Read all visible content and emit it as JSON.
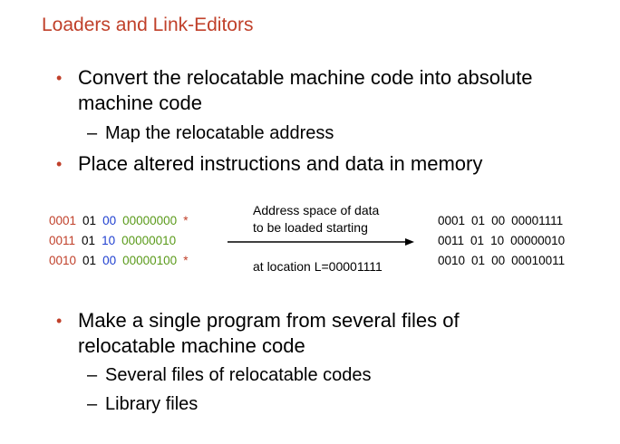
{
  "title": "Loaders and Link-Editors",
  "bullets": [
    {
      "text": "Convert the relocatable machine code into absolute machine code"
    },
    {
      "text": "Place altered instructions and data in memory"
    },
    {
      "text": "Make a single program from several files of relocatable machine code"
    }
  ],
  "subbullets": {
    "b1": [
      "Map the relocatable address"
    ],
    "b3": [
      "Several files of relocatable codes",
      "Library files"
    ]
  },
  "dash": "–",
  "bullet_glyph": "•",
  "left_code": [
    {
      "op": "0001",
      "r": "01",
      "mode": "00",
      "addr": "00000000",
      "mark": "*"
    },
    {
      "op": "0011",
      "r": "01",
      "mode": "10",
      "addr": "00000010",
      "mark": ""
    },
    {
      "op": "0010",
      "r": "01",
      "mode": "00",
      "addr": "00000100",
      "mark": "*"
    }
  ],
  "arrow": {
    "label_top_line1": "Address space of data",
    "label_top_line2": "to be loaded starting",
    "label_bottom": "at location L=00001111"
  },
  "right_code": [
    {
      "op": "0001",
      "r": "01",
      "mode": "00",
      "addr": "00001111"
    },
    {
      "op": "0011",
      "r": "01",
      "mode": "10",
      "addr": "00000010"
    },
    {
      "op": "0010",
      "r": "01",
      "mode": "00",
      "addr": "00010011"
    }
  ],
  "colors": {
    "title": "#c0402a",
    "opcode": "#c0402a",
    "mode": "#1f3fd0",
    "address": "#5a9a1a"
  }
}
